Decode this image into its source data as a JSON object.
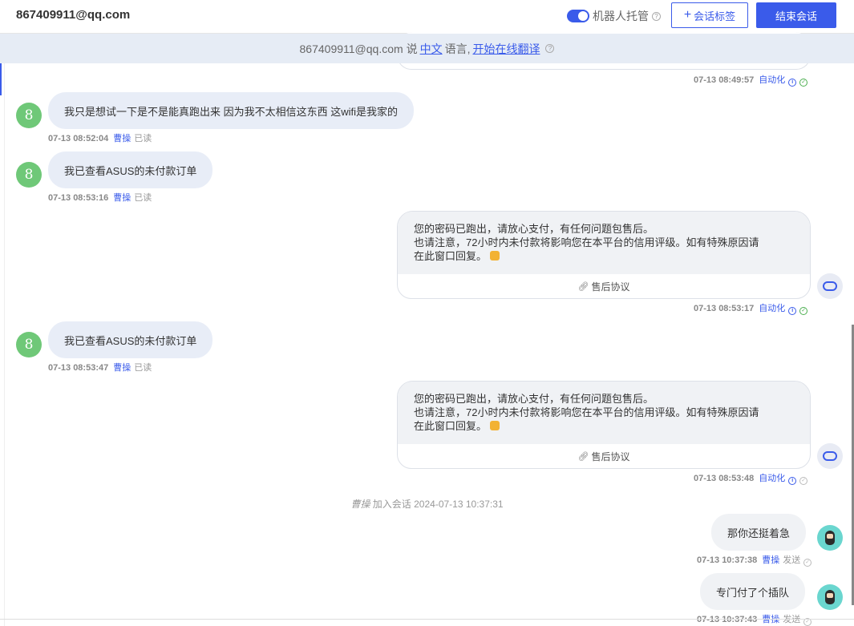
{
  "header": {
    "title": "867409911@qq.com",
    "robot_toggle_label": "机器人托管",
    "tag_button": "会话标签",
    "end_button": "结束会话"
  },
  "banner": {
    "prefix": "867409911@qq.com 说",
    "language": "中文",
    "mid": "语言,",
    "translate": "开始在线翻译"
  },
  "messages": {
    "m0": {
      "time": "07-13 08:49:57",
      "status": "自动化"
    },
    "m1": {
      "avatar": "8",
      "text": "我只是想试一下是不是能真跑出来 因为我不太相信这东西 这wifi是我家的",
      "time": "07-13 08:52:04",
      "who": "曹操",
      "read": "已读"
    },
    "m2": {
      "avatar": "8",
      "text": "我已查看ASUS的未付款订单",
      "time": "07-13 08:53:16",
      "who": "曹操",
      "read": "已读"
    },
    "m3": {
      "line1": "您的密码已跑出，请放心支付，有任何问题包售后。",
      "line2": "也请注意，72小时内未付款将影响您在本平台的信用评级。如有特殊原因请",
      "line3": "在此窗口回复。",
      "link": "售后协议",
      "time": "07-13 08:53:17",
      "status": "自动化"
    },
    "m4": {
      "avatar": "8",
      "text": "我已查看ASUS的未付款订单",
      "time": "07-13 08:53:47",
      "who": "曹操",
      "read": "已读"
    },
    "m5": {
      "line1": "您的密码已跑出，请放心支付，有任何问题包售后。",
      "line2": "也请注意，72小时内未付款将影响您在本平台的信用评级。如有特殊原因请",
      "line3": "在此窗口回复。",
      "link": "售后协议",
      "time": "07-13 08:53:48",
      "status": "自动化"
    },
    "sys": {
      "name": "曹操",
      "text": "加入会话 2024-07-13 10:37:31"
    },
    "m6": {
      "text": "那你还挺着急",
      "time": "07-13 10:37:38",
      "who": "曹操",
      "sent": "发送"
    },
    "m7": {
      "text": "专门付了个插队",
      "time": "07-13 10:37:43",
      "who": "曹操",
      "sent": "发送"
    }
  },
  "colors": {
    "accent": "#3a5bea",
    "user_avatar": "#6fc878",
    "agent_avatar_bg": "#6ad6cf"
  },
  "icons": [
    "help-icon",
    "plus-icon",
    "info-icon",
    "check-icon",
    "link-icon",
    "bot-icon",
    "emoji-icon"
  ]
}
